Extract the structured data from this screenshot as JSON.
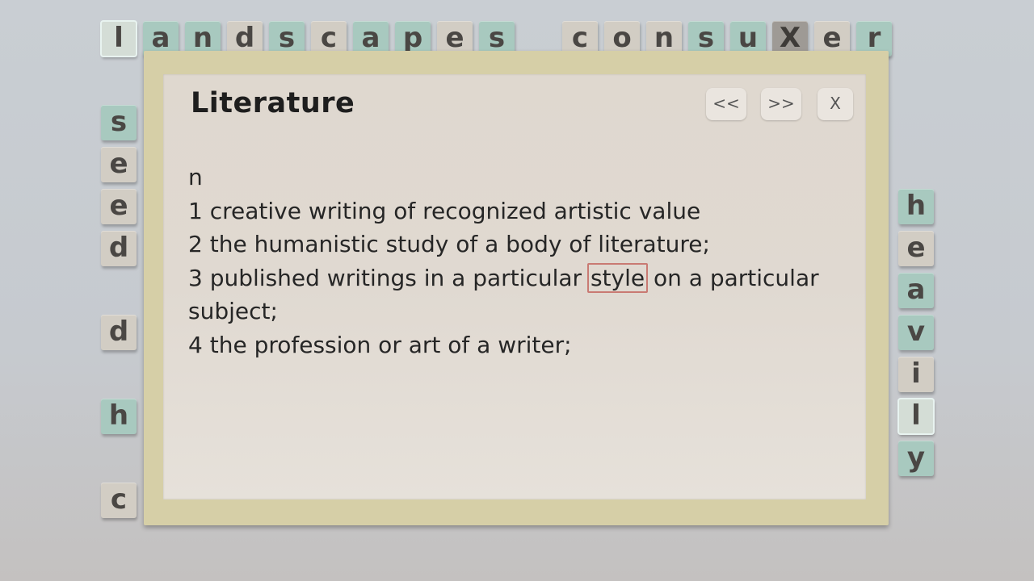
{
  "top_row_word_1": [
    "l",
    "a",
    "n",
    "d",
    "s",
    "c",
    "a",
    "p",
    "e",
    "s"
  ],
  "top_row_word_2": [
    "c",
    "o",
    "n",
    "s",
    "u",
    "X",
    "e",
    "r"
  ],
  "left_column": [
    "s",
    "e",
    "e",
    "d",
    "d",
    "h",
    "c"
  ],
  "right_column": [
    "h",
    "e",
    "a",
    "v",
    "i",
    "l",
    "y"
  ],
  "dialog": {
    "title": "Literature",
    "prev_label": "<<",
    "next_label": ">>",
    "close_label": "X",
    "pos": "n",
    "def1": "1 creative writing of recognized artistic value",
    "def2": "2 the humanistic study of a body of literature;",
    "def3_before": "3 published writings in a particular ",
    "def3_link": "style",
    "def3_after": " on a particular subject;",
    "def4": "4 the profession or art of a writer;"
  }
}
